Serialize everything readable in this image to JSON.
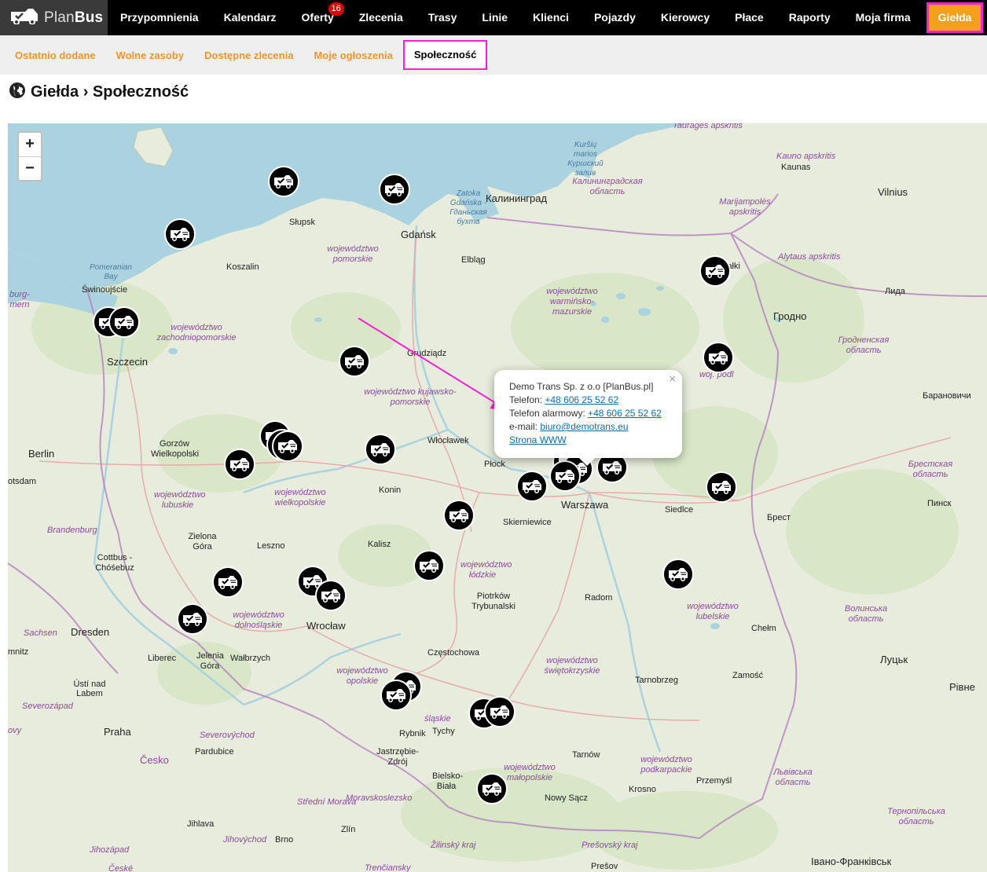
{
  "logo": {
    "plan": "Plan",
    "bus": "Bus",
    "icon": "truck-logo-icon"
  },
  "nav": [
    {
      "label": "Przypomnienia"
    },
    {
      "label": "Kalendarz"
    },
    {
      "label": "Oferty",
      "badge": "16"
    },
    {
      "label": "Zlecenia"
    },
    {
      "label": "Trasy"
    },
    {
      "label": "Linie"
    },
    {
      "label": "Klienci"
    },
    {
      "label": "Pojazdy"
    },
    {
      "label": "Kierowcy"
    },
    {
      "label": "Płace"
    },
    {
      "label": "Raporty"
    },
    {
      "label": "Moja firma"
    },
    {
      "label": "Giełda",
      "active": true
    }
  ],
  "subnav": [
    {
      "label": "Ostatnio dodane"
    },
    {
      "label": "Wolne zasoby"
    },
    {
      "label": "Dostępne zlecenia"
    },
    {
      "label": "Moje ogłoszenia"
    },
    {
      "label": "Społeczność",
      "active": true
    }
  ],
  "page": {
    "title": "Giełda › Społeczność",
    "icon": "globe-icon"
  },
  "map": {
    "zoom_in": "+",
    "zoom_out": "−",
    "labels": {
      "slupsk": "Słupsk",
      "gdansk": "Gdańsk",
      "kaliningrad": "Калининград",
      "koszalin": "Koszalin",
      "elblag": "Elbląg",
      "swinoujscie": "Świnoujście",
      "szczecin": "Szczecin",
      "grudziadz": "Grudziądz",
      "wloclawek": "Włocławek",
      "plock": "Płock",
      "warszawa": "Warszawa",
      "konin": "Konin",
      "skierniewice": "Skierniewice",
      "siedlce": "Siedlce",
      "kalisz": "Kalisz",
      "leszno": "Leszno",
      "zielona_gora": "Zielona Góra",
      "gorzow": "Gorzów Wielkopolski",
      "berlin": "Berlin",
      "brandenburg": "Brandenburg",
      "cottbus": "Cottbus - Chóśebuz",
      "dresden": "Dresden",
      "sachsen": "Sachsen",
      "wroclaw": "Wrocław",
      "jelenia_gora": "Jelenia Góra",
      "walbrzych": "Wałbrzych",
      "liberec": "Liberec",
      "usti": "Ústí nad Labem",
      "praha": "Praha",
      "cesko": "Česko",
      "pardubice": "Pardubice",
      "czestochowa": "Częstochowa",
      "piotrkow": "Piotrków Trybunalski",
      "radom": "Radom",
      "tarnobrzeg": "Tarnobrzeg",
      "zamosc": "Zamość",
      "chelm": "Chełm",
      "rybnik": "Rybnik",
      "tychy": "Tychy",
      "jastrzebie": "Jastrzębie-Zdrój",
      "bielsko": "Bielsko-Biała",
      "tarnow": "Tarnów",
      "krosno": "Krosno",
      "przemysl": "Przemyśl",
      "nowy_sacz": "Nowy Sącz",
      "zlin": "Zlín",
      "brno": "Brno",
      "jihlava": "Jihlava",
      "presov": "Prešov",
      "suwalki": "Suwałki",
      "grodno": "Гродно",
      "lida": "Лида",
      "vilnius": "Vilnius",
      "kaunas": "Kaunas",
      "baranovichi": "Барановичи",
      "pinsk": "Пинск",
      "brest": "Брест",
      "lutsk": "Луцьк",
      "rivne": "Рівне",
      "ivano": "Івано-Франківськ",
      "lviv_obl": "Львівська область",
      "volyn_obl": "Волинська область",
      "brest_obl": "Брестская область",
      "grodno_obl": "Гродненская область",
      "kaliningrad_obl": "Калининградская область",
      "ternopil_obl": "Тернопільська область",
      "marijampoles": "Marijampolės apskritis",
      "alytaus": "Alytaus apskritis",
      "kauno": "Kauno apskritis",
      "taurages": "Tauragės apskritis",
      "pomorskie": "województwo pomorskie",
      "zachodniopomorskie": "województwo zachodniopomorskie",
      "warminsko": "województwo warmińsko-mazurskie",
      "kujawsko": "województwo kujawsko-pomorskie",
      "wielkopolskie": "województwo wielkopolskie",
      "lubuskie": "województwo lubuskie",
      "dolnoslaskie": "województwo dolnośląskie",
      "opolskie": "województwo opolskie",
      "lodzkie": "województwo łódzkie",
      "swietokrzyskie": "województwo świętokrzyskie",
      "lubelskie": "województwo lubelskie",
      "podkarpackie": "województwo podkarpackie",
      "malopolskie": "województwo małopolskie",
      "slaskie": "śląskie",
      "podlaskie": "woj. podl",
      "zatoka": "Zatoka Gdańska - Гданьская бухта",
      "kursiu": "Kuršių marios Куршский залив",
      "pomeranian_bay": "Pomeranian Bay",
      "severozapad": "Severozápad",
      "severovychod": "Severovýchod",
      "moravskoslezsko": "Moravskoslezsko",
      "stredni_morava": "Střední Morava",
      "jihovychod": "Jihovýchod",
      "jihozapad": "Jihozápad",
      "zilinsky": "Žilinský kraj",
      "presovsky": "Prešovský kraj",
      "trencinsky": "Trenčiansky",
      "burgmern": "burg-mern",
      "otsdam": "otsdam",
      "mnitz": "mnitz",
      "ovy": "ovy",
      "ceske": "České"
    }
  },
  "popup": {
    "company": "Demo Trans Sp. z o.o [PlanBus.pl]",
    "phone_label": "Telefon:",
    "phone": "+48 606 25 52 62",
    "alarm_label": "Telefon alarmowy:",
    "alarm_phone": "+48 606 25 52 62",
    "email_label": "e-mail:",
    "email": "biuro@demotrans.eu",
    "www": "Strona WWW",
    "close": "×"
  },
  "colors": {
    "accent": "#f5a01a",
    "highlight": "#ff1fd2",
    "annotation_arrow": "#ff1fd2",
    "sea": "#aad3df"
  }
}
